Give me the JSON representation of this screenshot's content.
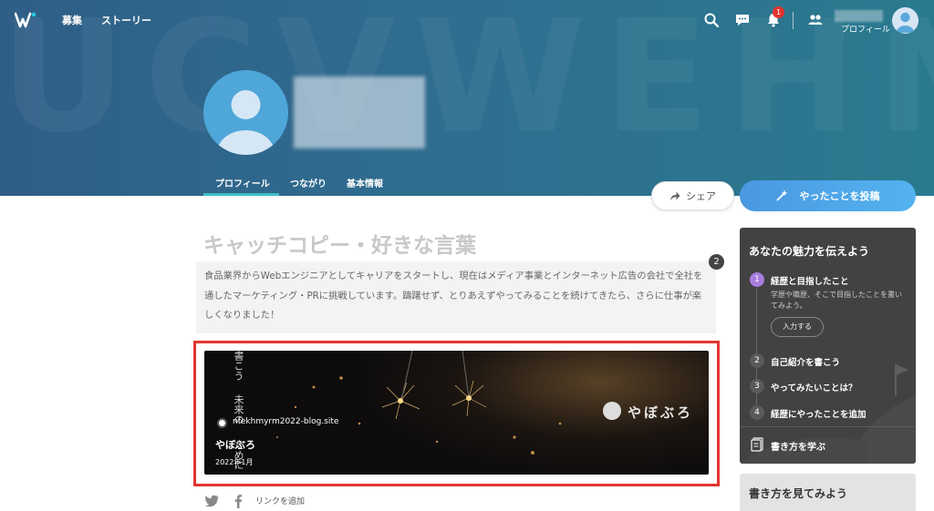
{
  "header": {
    "nav": [
      "募集",
      "ストーリー"
    ],
    "notification_count": "1",
    "profile_label": "プロフィール"
  },
  "profile": {
    "tabs": [
      "プロフィール",
      "つながり",
      "基本情報"
    ]
  },
  "actions": {
    "share_label": "シェア",
    "post_label": "やったことを投稿"
  },
  "catch": {
    "title": "キャッチコピー・好きな言葉",
    "text": "食品業界からWebエンジニアとしてキャリアをスタートし、現在はメディア事業とインターネット広告の会社で全社を通したマーケティング・PRに挑戦しています。躊躇せず、とりあえずやってみることを続けてきたら、さらに仕事が楽しくなりました！",
    "badge": "2"
  },
  "link_card": {
    "site": "nfekhmyrm2022-blog.site",
    "title": "やぼぶろ",
    "date": "2022年1月",
    "logo_text": "やぼぶろ",
    "image_text_1": "書こう",
    "image_text_2": "未来の",
    "image_text_3": "ために"
  },
  "share_row": {
    "add_link_label": "リンクを追加"
  },
  "sidebar": {
    "title": "あなたの魅力を伝えよう",
    "steps": [
      {
        "num": "1",
        "label": "経歴と目指したこと",
        "desc": "学歴や職歴、そこで目指したことを書いてみよう。"
      },
      {
        "num": "2",
        "label": "自己紹介を書こう"
      },
      {
        "num": "3",
        "label": "やってみたいことは？"
      },
      {
        "num": "4",
        "label": "経歴にやったことを追加"
      }
    ],
    "input_button": "入力する",
    "learn_label": "書き方を学ぶ",
    "panel2_title": "書き方を見てみよう"
  },
  "colors": {
    "accent_teal": "#3cc0c6",
    "post_button": "#4a98e0",
    "active_step": "#a77ee0",
    "notification": "#e3342f"
  }
}
